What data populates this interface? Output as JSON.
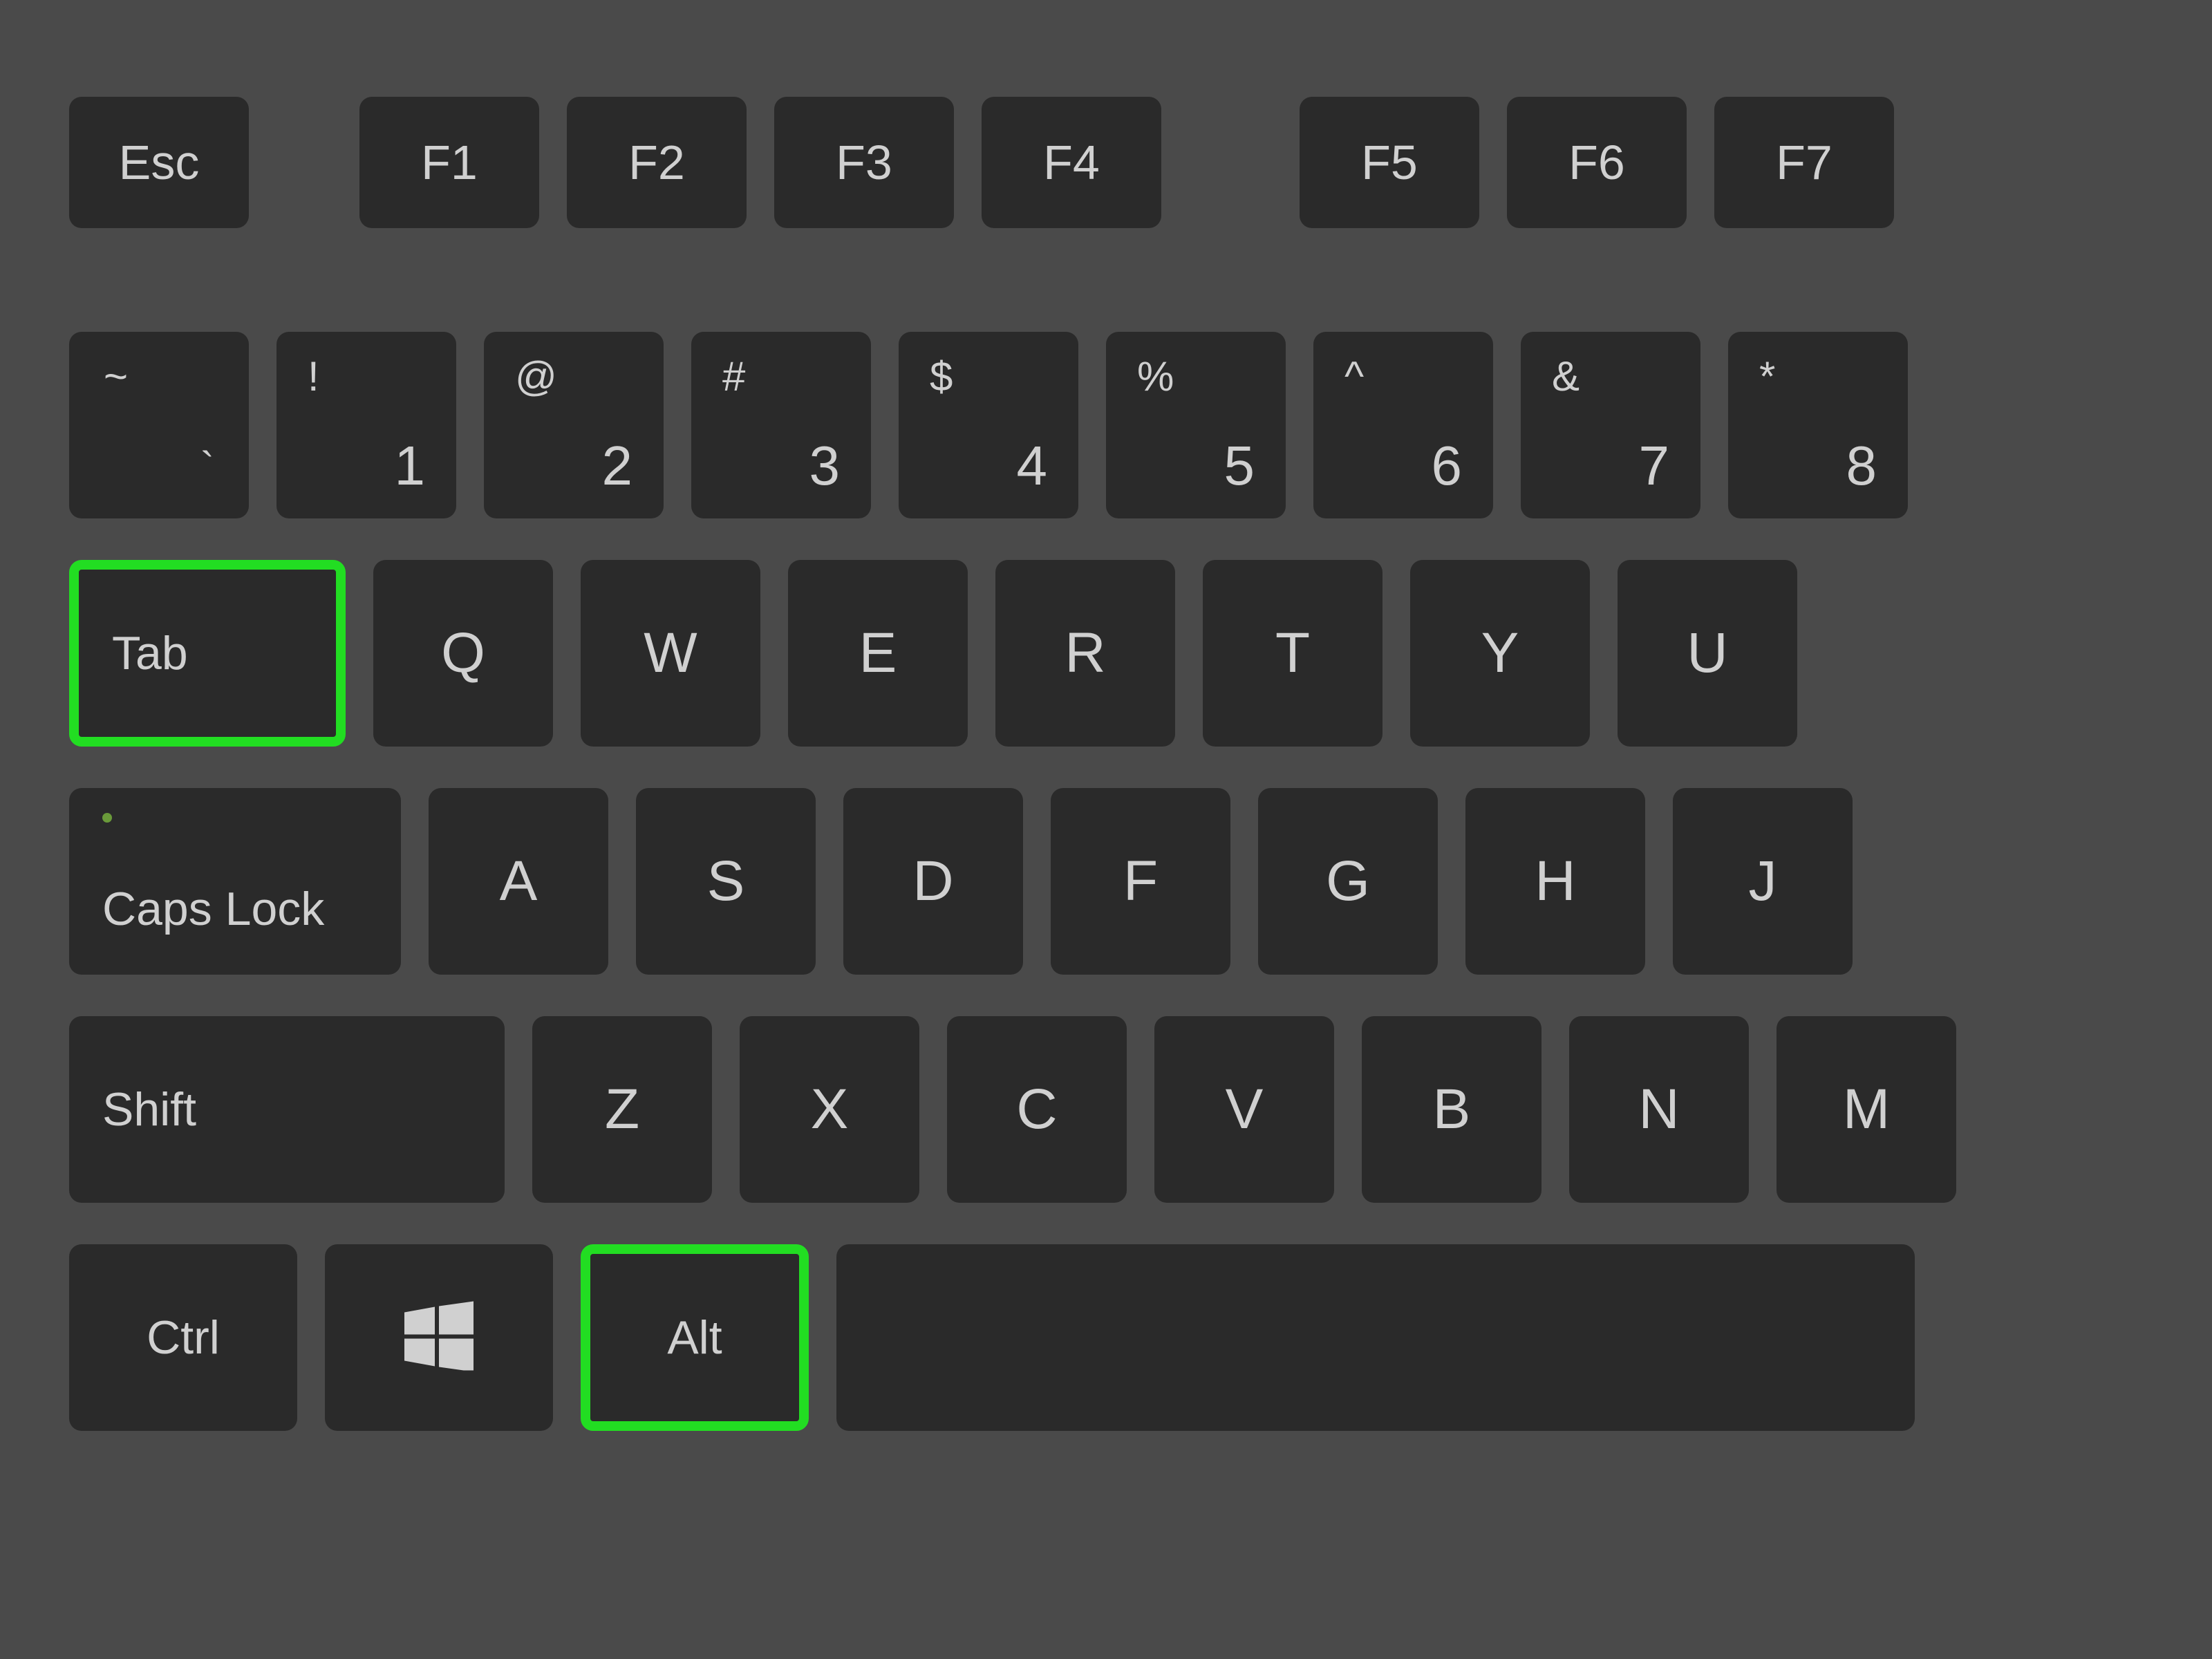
{
  "function_row": {
    "esc": "Esc",
    "keys": [
      "F1",
      "F2",
      "F3",
      "F4",
      "F5",
      "F6",
      "F7"
    ]
  },
  "number_row": {
    "tilde": {
      "top": "~",
      "bottom": "`"
    },
    "keys": [
      {
        "top": "!",
        "bottom": "1"
      },
      {
        "top": "@",
        "bottom": "2"
      },
      {
        "top": "#",
        "bottom": "3"
      },
      {
        "top": "$",
        "bottom": "4"
      },
      {
        "top": "%",
        "bottom": "5"
      },
      {
        "top": "^",
        "bottom": "6"
      },
      {
        "top": "&",
        "bottom": "7"
      },
      {
        "top": "*",
        "bottom": "8"
      }
    ]
  },
  "qwerty_row": {
    "tab": "Tab",
    "keys": [
      "Q",
      "W",
      "E",
      "R",
      "T",
      "Y",
      "U"
    ]
  },
  "home_row": {
    "caps": "Caps Lock",
    "keys": [
      "A",
      "S",
      "D",
      "F",
      "G",
      "H",
      "J"
    ]
  },
  "shift_row": {
    "shift": "Shift",
    "keys": [
      "Z",
      "X",
      "C",
      "V",
      "B",
      "N",
      "M"
    ]
  },
  "bottom_row": {
    "ctrl": "Ctrl",
    "alt": "Alt"
  },
  "highlights": [
    "tab",
    "alt"
  ],
  "colors": {
    "background": "#4a4a4a",
    "key": "#2a2a2a",
    "text": "#d0d0d0",
    "highlight": "#22dd22"
  }
}
